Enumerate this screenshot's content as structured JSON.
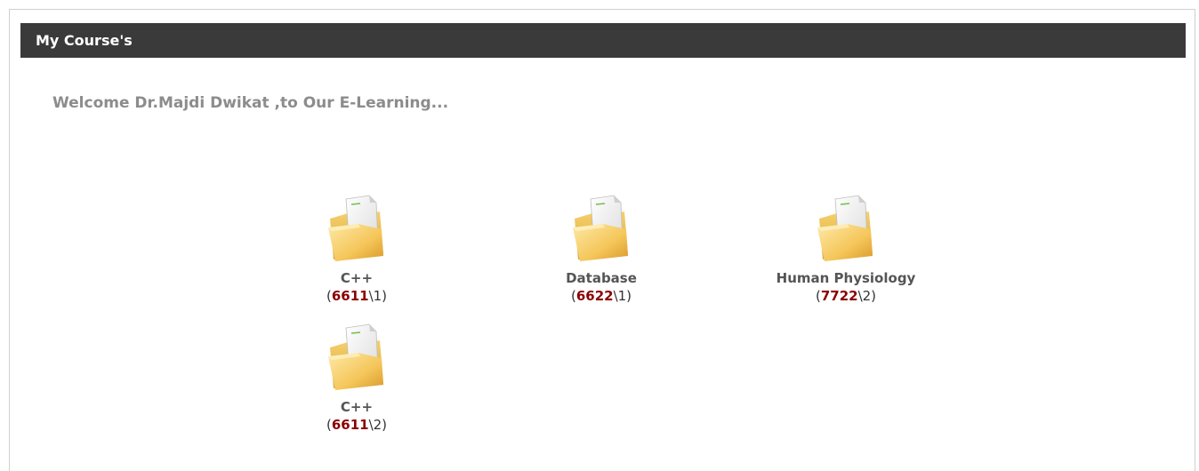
{
  "panel": {
    "title": "My Course's"
  },
  "welcome_text": "Welcome Dr.Majdi Dwikat ,to Our E-Learning...",
  "courses": [
    {
      "name": "C++",
      "open_paren": "(",
      "code": "6611",
      "section": "\\1)",
      "icon": "folder-icon"
    },
    {
      "name": "Database",
      "open_paren": "(",
      "code": "6622",
      "section": "\\1)",
      "icon": "folder-icon"
    },
    {
      "name": "Human Physiology",
      "open_paren": "(",
      "code": "7722",
      "section": "\\2)",
      "icon": "folder-icon"
    },
    {
      "name": "C++",
      "open_paren": "(",
      "code": "6611",
      "section": "\\2)",
      "icon": "folder-icon"
    }
  ],
  "colors": {
    "header_bg": "#3a3a3a",
    "welcome_text": "#8c8c8c",
    "course_code": "#8b0000"
  }
}
